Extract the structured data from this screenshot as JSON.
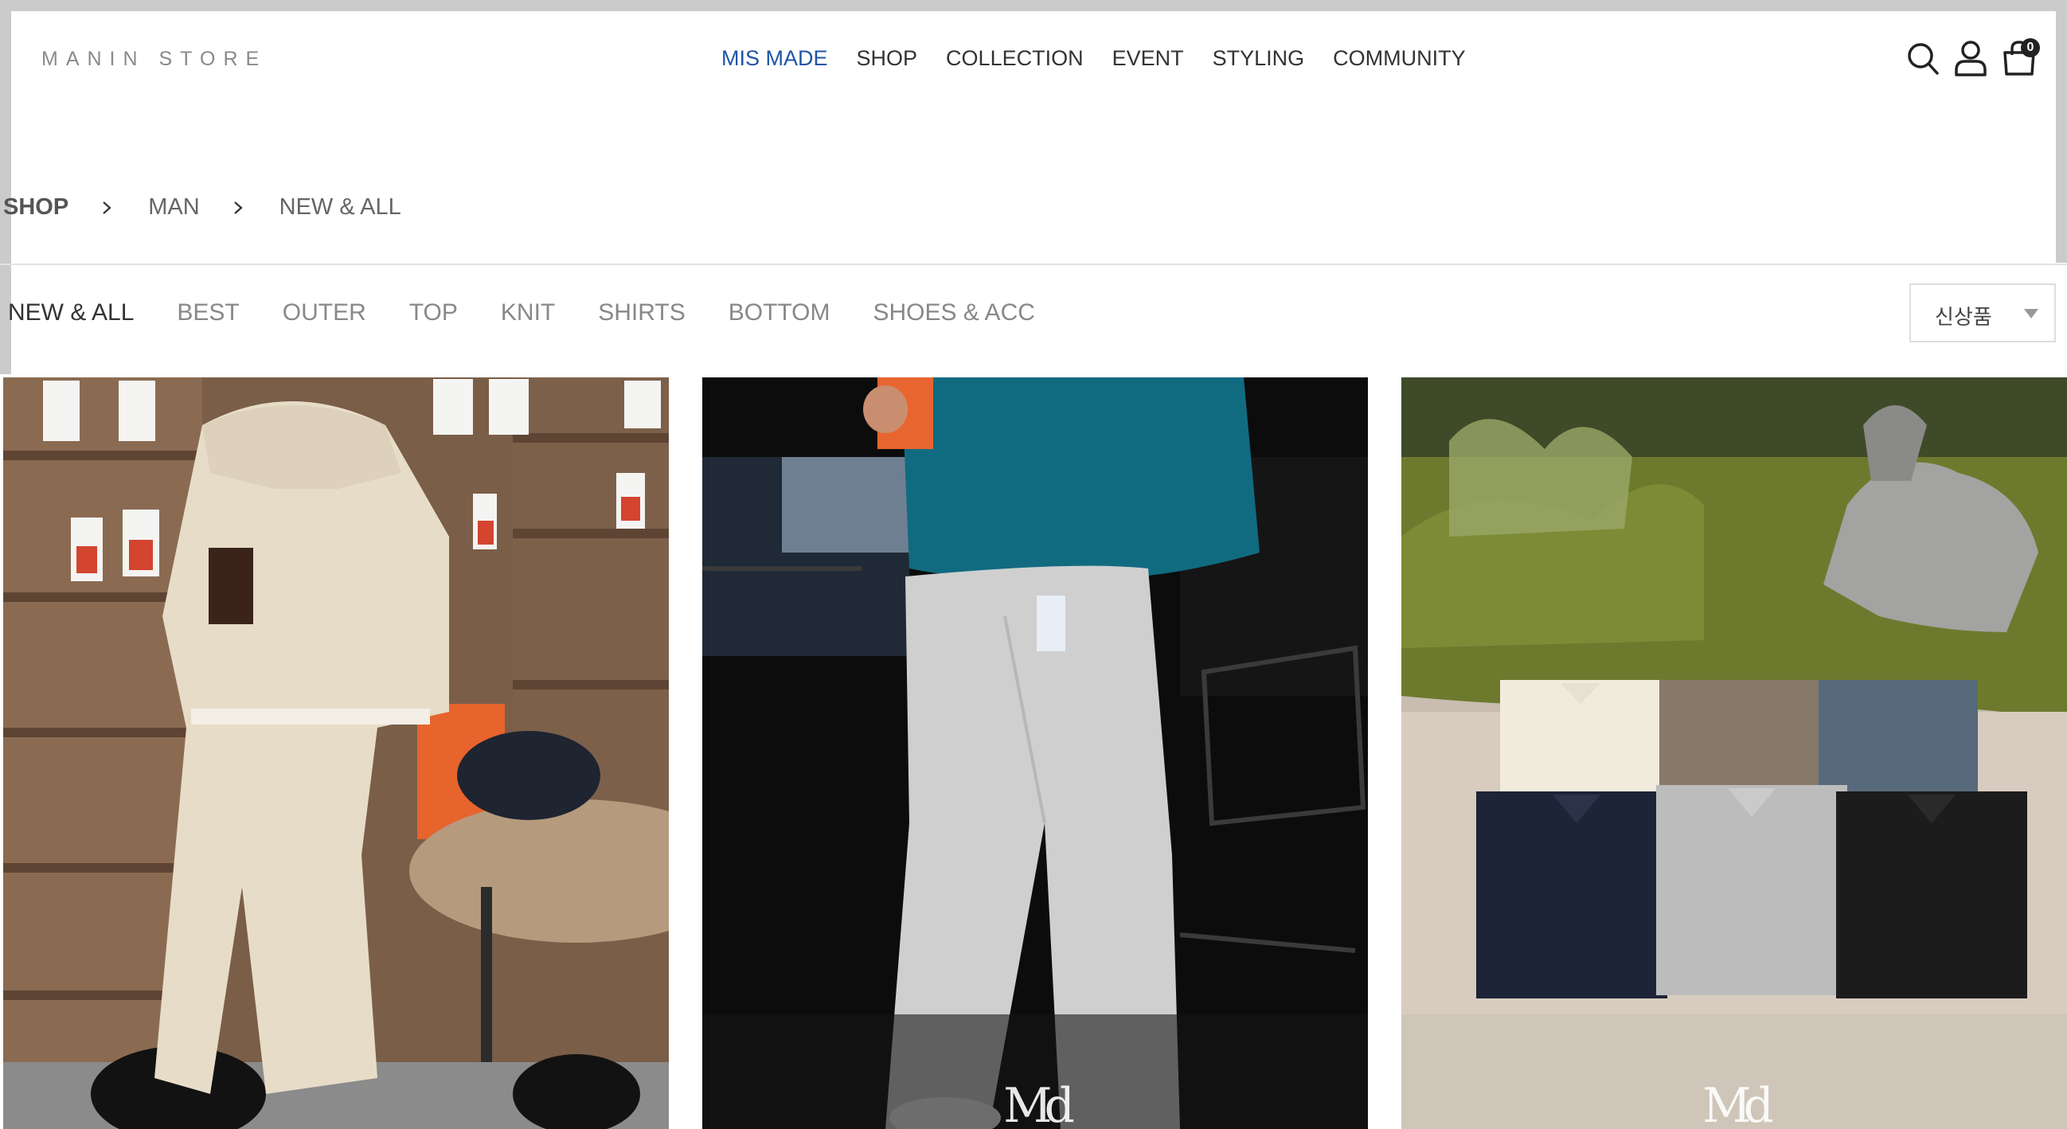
{
  "header": {
    "logo": "MANIN STORE",
    "nav": [
      {
        "label": "MIS MADE",
        "active": true
      },
      {
        "label": "SHOP",
        "active": false
      },
      {
        "label": "COLLECTION",
        "active": false
      },
      {
        "label": "EVENT",
        "active": false
      },
      {
        "label": "STYLING",
        "active": false
      },
      {
        "label": "COMMUNITY",
        "active": false
      }
    ],
    "icons": [
      "search-icon",
      "user-icon",
      "cart-icon"
    ],
    "cart_count": "0",
    "accent_color": "#1f54a8"
  },
  "breadcrumb": [
    "SHOP",
    "MAN",
    "NEW & ALL"
  ],
  "categories": [
    {
      "label": "NEW & ALL",
      "active": true
    },
    {
      "label": "BEST",
      "active": false
    },
    {
      "label": "OUTER",
      "active": false
    },
    {
      "label": "TOP",
      "active": false
    },
    {
      "label": "KNIT",
      "active": false
    },
    {
      "label": "SHIRTS",
      "active": false
    },
    {
      "label": "BOTTOM",
      "active": false
    },
    {
      "label": "SHOES & ACC",
      "active": false
    }
  ],
  "sort": {
    "selected": "신상품"
  },
  "products": [
    {
      "image": "beige fleece set in cafe"
    },
    {
      "image": "teal fleece and grey sweatpants",
      "watermark": "Md"
    },
    {
      "image": "folded knit polo shirts on moss",
      "watermark": "Md"
    }
  ]
}
